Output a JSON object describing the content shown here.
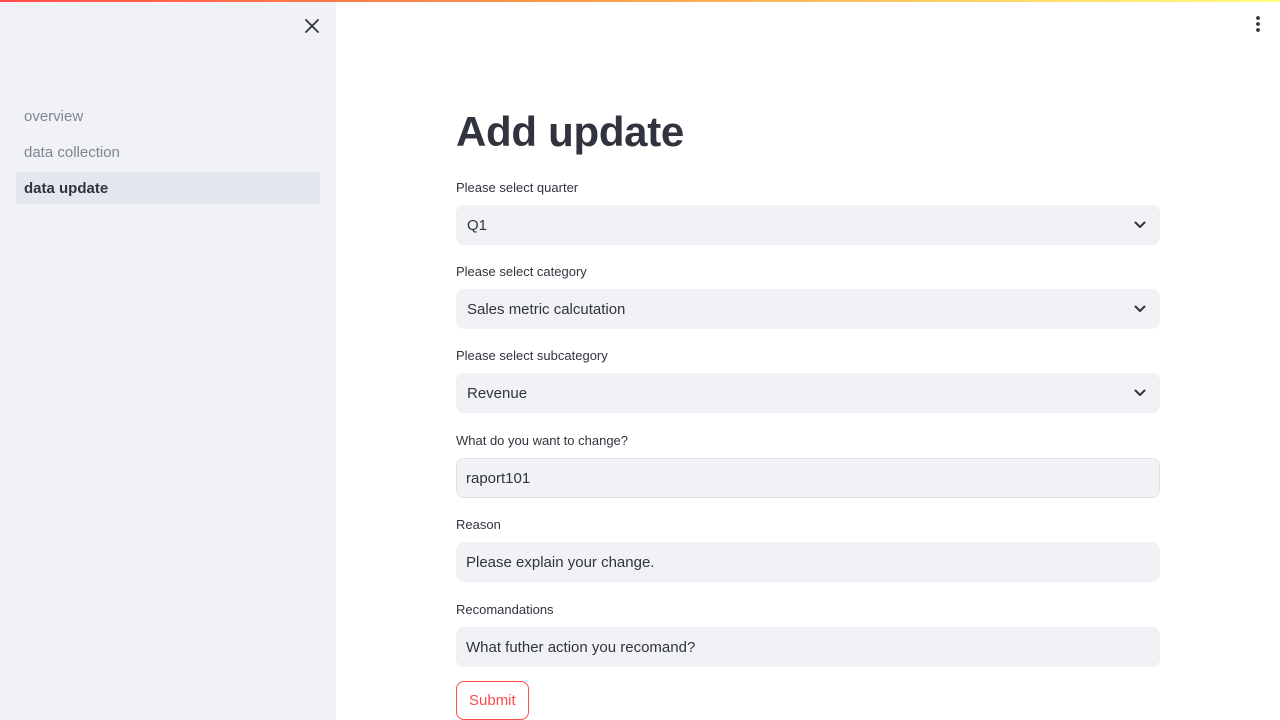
{
  "sidebar": {
    "close_icon": "close-icon",
    "items": [
      {
        "label": "overview",
        "active": false
      },
      {
        "label": "data collection",
        "active": false
      },
      {
        "label": "data update",
        "active": true
      }
    ]
  },
  "header": {
    "menu_icon": "vertical-ellipsis-icon"
  },
  "main": {
    "title": "Add update",
    "fields": {
      "quarter": {
        "label": "Please select quarter",
        "value": "Q1"
      },
      "category": {
        "label": "Please select category",
        "value": "Sales metric calcutation"
      },
      "subcategory": {
        "label": "Please select subcategory",
        "value": "Revenue"
      },
      "change": {
        "label": "What do you want to change?",
        "value": "raport101"
      },
      "reason": {
        "label": "Reason",
        "placeholder": "Please explain your change."
      },
      "recommendations": {
        "label": "Recomandations",
        "placeholder": "What futher action you recomand?"
      }
    },
    "submit_label": "Submit"
  },
  "colors": {
    "accent": "#ff4b4b",
    "sidebar_bg": "#f0f2f6",
    "text": "#31333f"
  }
}
